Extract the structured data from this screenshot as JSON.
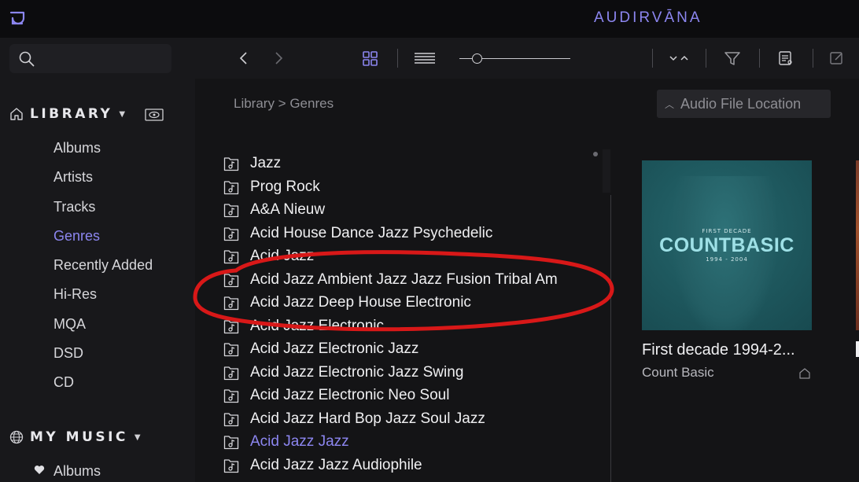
{
  "app": {
    "brand": "AUDIRVĀNA"
  },
  "toolbar": {
    "search_placeholder": "",
    "icons": [
      "search-icon",
      "back-icon",
      "forward-icon",
      "grid-view-icon",
      "list-view-icon",
      "zoom-slider",
      "sort-order-icon",
      "filter-icon",
      "playlist-icon",
      "edit-icon"
    ],
    "zoom_level": 0.12
  },
  "sidebar": {
    "library_title": "LIBRARY",
    "library_items": [
      {
        "label": "Albums"
      },
      {
        "label": "Artists"
      },
      {
        "label": "Tracks"
      },
      {
        "label": "Genres",
        "active": true
      },
      {
        "label": "Recently Added"
      },
      {
        "label": "Hi-Res"
      },
      {
        "label": "MQA"
      },
      {
        "label": "DSD"
      },
      {
        "label": "CD"
      }
    ],
    "my_music_title": "MY MUSIC",
    "my_music_items": [
      {
        "label": "Albums"
      }
    ]
  },
  "main": {
    "breadcrumb": "Library > Genres",
    "sort_button": "Audio File Location",
    "genres": [
      " Jazz",
      " Prog Rock",
      "A&A Nieuw",
      "Acid House Dance Jazz Psychedelic",
      "Acid Jazz",
      "Acid Jazz Ambient Jazz Jazz Fusion Tribal Am",
      "Acid Jazz Deep House Electronic",
      "Acid Jazz Electronic",
      "Acid Jazz Electronic Jazz",
      "Acid Jazz Electronic Jazz Swing",
      "Acid Jazz Electronic Neo Soul",
      "Acid Jazz Hard Bop Jazz Soul Jazz",
      "Acid Jazz Jazz",
      "Acid Jazz Jazz Audiophile"
    ],
    "active_genre_index": 12
  },
  "album": {
    "cover_small_top": "FIRST DECADE",
    "cover_title": "COUNTBASIC",
    "cover_small_bottom": "1994 - 2004",
    "title": "First decade 1994-2...",
    "artist": "Count Basic"
  },
  "colors": {
    "accent": "#8c86f0",
    "background": "#121214",
    "sidebar": "#18181b",
    "annotation": "#d81818"
  }
}
